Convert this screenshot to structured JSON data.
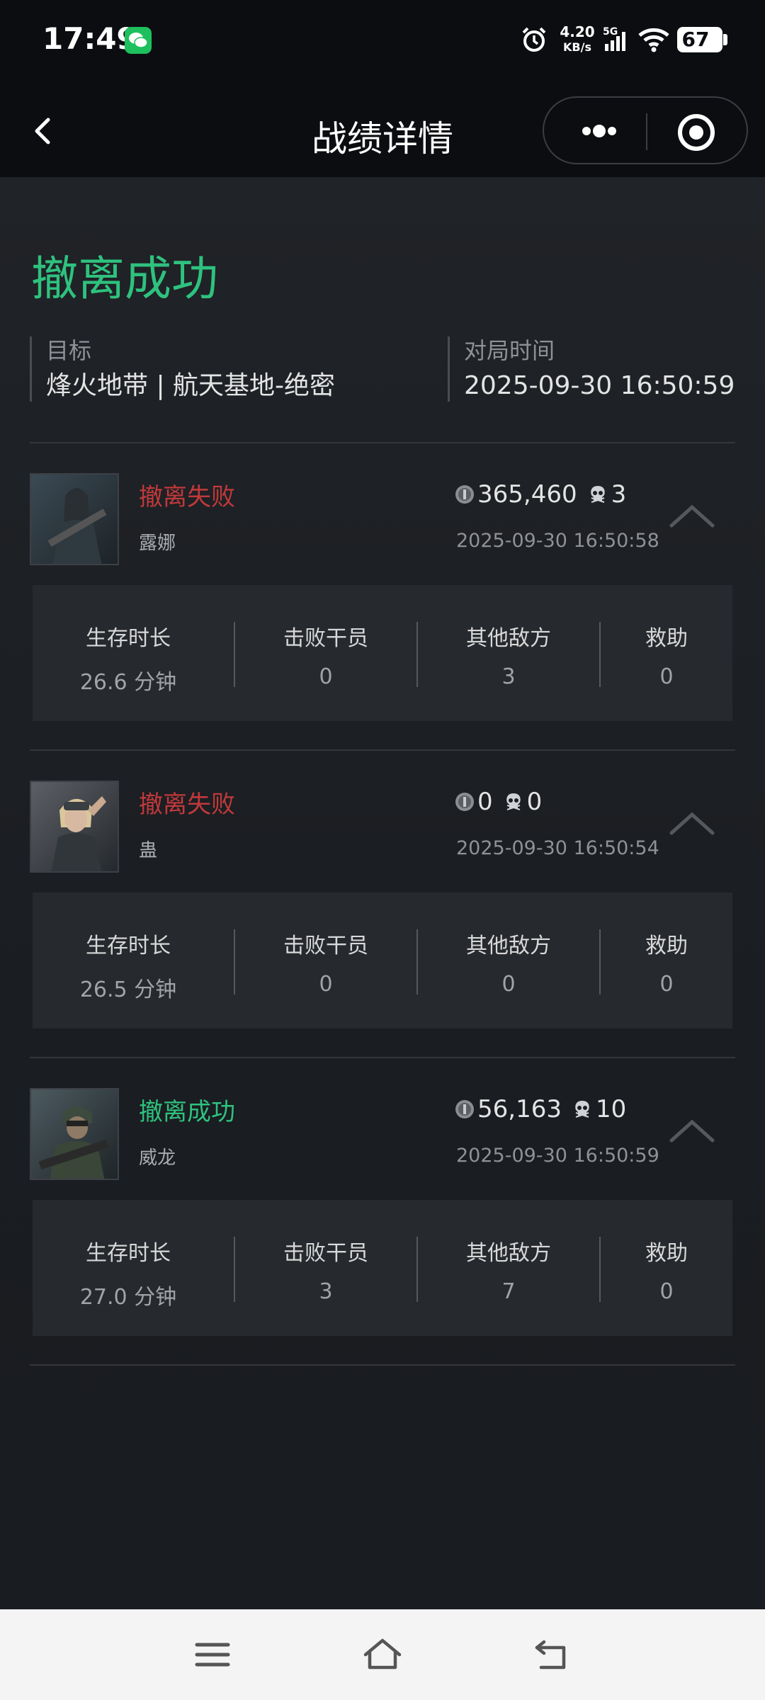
{
  "status_bar": {
    "time": "17:49",
    "net_speed_value": "4.20",
    "net_speed_unit": "KB/s",
    "network_type": "5G",
    "battery": "67"
  },
  "title_bar": {
    "title": "战绩详情"
  },
  "summary": {
    "status": "撤离成功",
    "status_color": "#2ec27e",
    "target_label": "目标",
    "target_value": "烽火地带 | 航天基地-绝密",
    "time_label": "对局时间",
    "time_value": "2025-09-30 16:50:59"
  },
  "stat_labels": {
    "survival": "生存时长",
    "operators": "击败干员",
    "others": "其他敌方",
    "assists": "救助"
  },
  "players": [
    {
      "status": "撤离失败",
      "outcome": "fail",
      "name": "露娜",
      "value": "365,460",
      "kills": "3",
      "time": "2025-09-30 16:50:58",
      "survival": "26.6 分钟",
      "operators": "0",
      "others": "3",
      "assists": "0"
    },
    {
      "status": "撤离失败",
      "outcome": "fail",
      "name": "蛊",
      "value": "0",
      "kills": "0",
      "time": "2025-09-30 16:50:54",
      "survival": "26.5 分钟",
      "operators": "0",
      "others": "0",
      "assists": "0"
    },
    {
      "status": "撤离成功",
      "outcome": "success",
      "name": "威龙",
      "value": "56,163",
      "kills": "10",
      "time": "2025-09-30 16:50:59",
      "survival": "27.0 分钟",
      "operators": "3",
      "others": "7",
      "assists": "0"
    }
  ],
  "colors": {
    "success": "#2ec27e",
    "fail": "#c0393b",
    "background": "#1b1e22"
  }
}
